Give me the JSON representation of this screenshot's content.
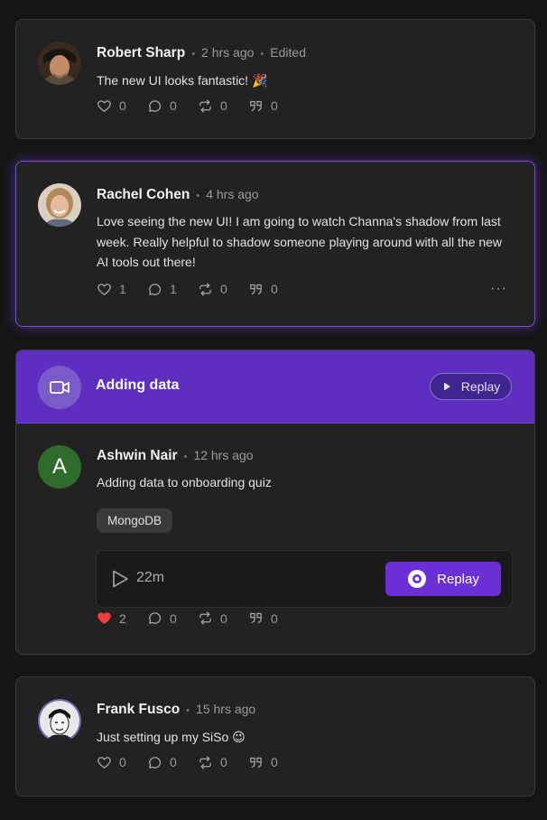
{
  "posts": [
    {
      "name": "Robert Sharp",
      "time": "2 hrs ago",
      "edited": "Edited",
      "text": "The new UI looks fantastic! 🎉",
      "likes": "0",
      "comments": "0",
      "reposts": "0",
      "quotes": "0"
    },
    {
      "name": "Rachel Cohen",
      "time": "4 hrs ago",
      "text_lines": [
        "Love seeing the new UI! I am going to watch Channa's shadow from last",
        "week. Really helpful to shadow someone playing around with all the new",
        "AI tools out there!"
      ],
      "likes": "1",
      "comments": "1",
      "reposts": "0",
      "quotes": "0",
      "more": "···"
    }
  ],
  "session": {
    "title": "Adding data",
    "replay_label": "Replay",
    "post": {
      "avatar_letter": "A",
      "name": "Ashwin Nair",
      "time": "12 hrs ago",
      "text": "Adding data to onboarding quiz",
      "tag": "MongoDB",
      "duration": "22m",
      "replay_button": "Replay",
      "likes": "2",
      "comments": "0",
      "reposts": "0",
      "quotes": "0"
    }
  },
  "post3": {
    "name": "Frank Fusco",
    "time": "15 hrs ago",
    "text": "Just setting up my SiSo 😉",
    "likes": "0",
    "comments": "0",
    "reposts": "0",
    "quotes": "0"
  },
  "colors": {
    "accent": "#6b2fd6",
    "header_purple": "#5e2ec0",
    "like_red": "#ef3b3b",
    "avatar_green": "#2f6b2a"
  }
}
